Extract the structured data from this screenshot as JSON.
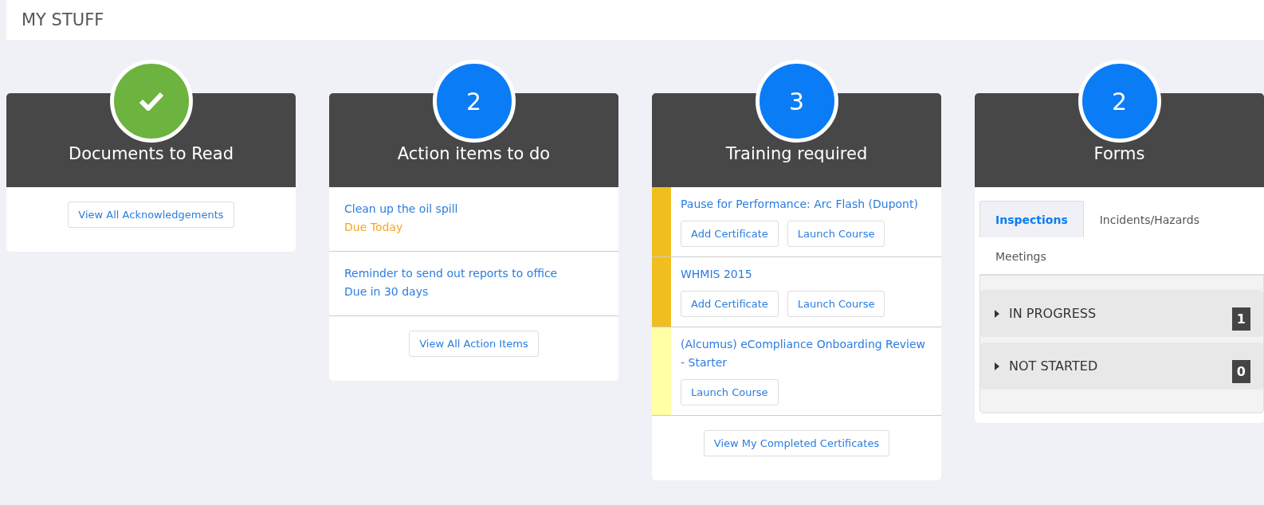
{
  "page_title": "MY STUFF",
  "cards": [
    {
      "kind": "documents",
      "badge": {
        "kind": "check"
      },
      "title": "Documents to Read",
      "footer_button": "View All Acknowledgements"
    },
    {
      "kind": "actions",
      "badge": {
        "kind": "count",
        "text": "2"
      },
      "title": "Action items to do",
      "items": [
        {
          "title": "Clean up the oil spill",
          "due": "Due Today",
          "color": "#f5a623"
        },
        {
          "title": "Reminder to send out reports to office",
          "due": "Due in 30 days",
          "color": "#2a7de1"
        }
      ],
      "footer_button": "View All Action Items"
    },
    {
      "kind": "training",
      "badge": {
        "kind": "count",
        "text": "3"
      },
      "title": "Training required",
      "items": [
        {
          "title": "Pause for Performance: Arc Flash (Dupont)",
          "color": "#f0bf1f",
          "buttons": [
            "Add Certificate",
            "Launch Course"
          ]
        },
        {
          "title": "WHMIS 2015",
          "color": "#f0bf1f",
          "buttons": [
            "Add Certificate",
            "Launch Course"
          ]
        },
        {
          "title": "(Alcumus) eCompliance Onboarding Review - Starter",
          "color": "#ffffa6",
          "buttons": [
            "Launch Course"
          ]
        }
      ],
      "footer_button": "View My Completed Certificates"
    },
    {
      "kind": "forms",
      "badge": {
        "kind": "count",
        "text": "2"
      },
      "title": "Forms",
      "tabs": [
        {
          "label": "Inspections",
          "selected": true
        },
        {
          "label": "Incidents/Hazards",
          "selected": false
        },
        {
          "label": "Meetings",
          "selected": false
        }
      ],
      "groups": [
        {
          "label": "IN PROGRESS",
          "count": "1",
          "expanded": false
        },
        {
          "label": "NOT STARTED",
          "count": "0",
          "expanded": false
        }
      ]
    }
  ]
}
